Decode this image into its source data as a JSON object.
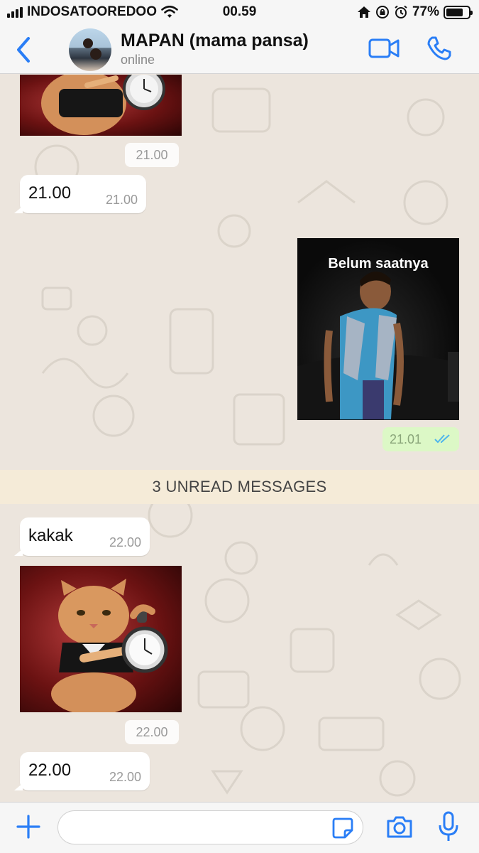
{
  "status_bar": {
    "carrier": "INDOSATOOREDOO",
    "time": "00.59",
    "battery": "77%",
    "battery_level": 0.77,
    "icons": [
      "signal-icon",
      "wifi-icon",
      "home-icon",
      "orientation-lock-icon",
      "alarm-icon",
      "battery-icon"
    ]
  },
  "header": {
    "contact_name": "MAPAN (mama pansa)",
    "contact_status": "online",
    "icons": [
      "back-chevron-icon",
      "video-call-icon",
      "phone-icon"
    ]
  },
  "messages": {
    "top_time_chip": "21.00",
    "msg1_text": "21.00",
    "msg1_time": "21.00",
    "photo_caption": "Belum saatnya",
    "photo_time": "21.01",
    "unread_label": "3 UNREAD MESSAGES",
    "msg2_text": "kakak",
    "msg2_time": "22.00",
    "cat_time_chip": "22.00",
    "msg3_text": "22.00",
    "msg3_time": "22.00"
  },
  "input_bar": {
    "placeholder": "",
    "icons": [
      "plus-icon",
      "sticker-icon",
      "camera-icon",
      "microphone-icon"
    ]
  },
  "colors": {
    "accent": "#2a7ef6",
    "chat_bg": "#ece5dd",
    "outgoing_bubble": "#dcf8c6",
    "read_ticks": "#4fb6ec",
    "unread_bar": "#f5ebd8"
  }
}
